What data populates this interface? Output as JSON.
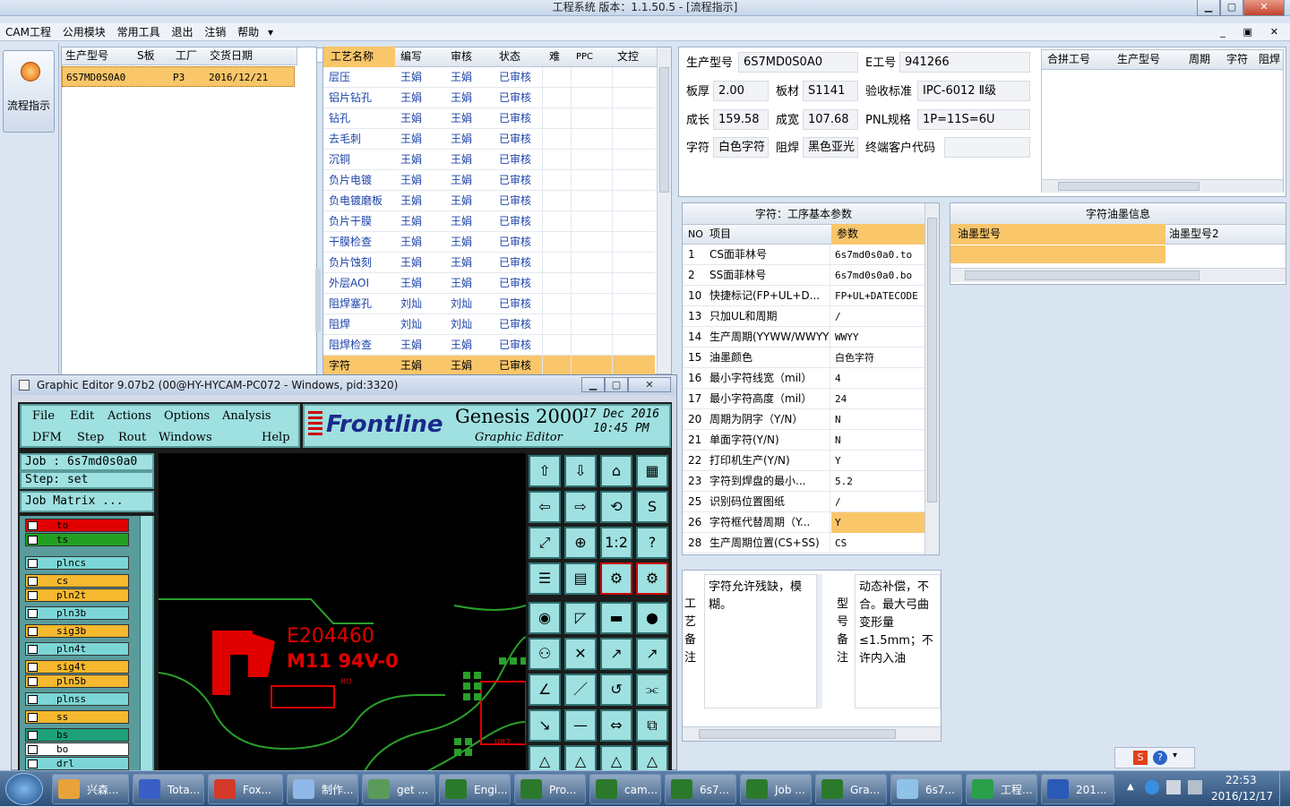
{
  "window": {
    "title": "工程系统   版本：1.1.50.5 - [流程指示]"
  },
  "menu": {
    "items": [
      "CAM工程",
      "公用模块",
      "常用工具",
      "退出",
      "注销",
      "帮助"
    ],
    "dropdown_arrow": "▾",
    "mdi_min": "_",
    "mdi_restore": "▣",
    "mdi_close": "✕"
  },
  "leftnav": {
    "flow_button": "流程指示"
  },
  "orders": {
    "headers": [
      "生产型号",
      "S板",
      "工厂",
      "交货日期"
    ],
    "rows": [
      [
        "6S7MD0S0A0",
        "",
        "P3",
        "2016/12/21"
      ]
    ]
  },
  "process": {
    "headers": [
      "工艺名称",
      "编写",
      "审核",
      "状态",
      "难",
      "PPC",
      "文控"
    ],
    "rows": [
      [
        "层压",
        "王娟",
        "王娟",
        "已审核"
      ],
      [
        "铝片钻孔",
        "王娟",
        "王娟",
        "已审核"
      ],
      [
        "钻孔",
        "王娟",
        "王娟",
        "已审核"
      ],
      [
        "去毛刺",
        "王娟",
        "王娟",
        "已审核"
      ],
      [
        "沉铜",
        "王娟",
        "王娟",
        "已审核"
      ],
      [
        "负片电镀",
        "王娟",
        "王娟",
        "已审核"
      ],
      [
        "负电镀磨板",
        "王娟",
        "王娟",
        "已审核"
      ],
      [
        "负片干膜",
        "王娟",
        "王娟",
        "已审核"
      ],
      [
        "干膜检查",
        "王娟",
        "王娟",
        "已审核"
      ],
      [
        "负片蚀刻",
        "王娟",
        "王娟",
        "已审核"
      ],
      [
        "外层AOI",
        "王娟",
        "王娟",
        "已审核"
      ],
      [
        "阻焊塞孔",
        "刘灿",
        "刘灿",
        "已审核"
      ],
      [
        "阻焊",
        "刘灿",
        "刘灿",
        "已审核"
      ],
      [
        "阻焊检查",
        "王娟",
        "王娟",
        "已审核"
      ],
      [
        "字符",
        "王娟",
        "王娟",
        "已审核"
      ]
    ]
  },
  "info": {
    "model_label": "生产型号",
    "model": "6S7MD0S0A0",
    "eno_label": "E工号",
    "eno": "941266",
    "thick_label": "板厚",
    "thick": "2.00",
    "material_label": "板材",
    "material": "S1141",
    "std_label": "验收标准",
    "std": "IPC-6012 Ⅱ级",
    "len_label": "成长",
    "len": "159.58",
    "wid_label": "成宽",
    "wid": "107.68",
    "pnl_label": "PNL规格",
    "pnl": "1P=11S=6U",
    "char_label": "字符",
    "char": "白色字符",
    "mask_label": "阻焊",
    "mask": "黑色亚光",
    "cust_label": "终端客户代码",
    "cust": ""
  },
  "merge": {
    "headers": [
      "合拼工号",
      "生产型号",
      "周期",
      "字符",
      "阻焊"
    ]
  },
  "params": {
    "title": "字符：工序基本参数",
    "headers": [
      "NO",
      "项目",
      "参数"
    ],
    "rows": [
      [
        "1",
        "CS面菲林号",
        "6s7md0s0a0.to"
      ],
      [
        "2",
        "SS面菲林号",
        "6s7md0s0a0.bo"
      ],
      [
        "10",
        "快捷标记(FP+UL+D...",
        "FP+UL+DATECODE"
      ],
      [
        "13",
        "只加UL和周期",
        "/"
      ],
      [
        "14",
        "生产周期(YYWW/WWYY)",
        "WWYY"
      ],
      [
        "15",
        "油墨颜色",
        "白色字符"
      ],
      [
        "16",
        "最小字符线宽（mil）",
        "4"
      ],
      [
        "17",
        "最小字符高度（mil）",
        "24"
      ],
      [
        "20",
        "周期为阴字（Y/N）",
        "N"
      ],
      [
        "21",
        "单面字符(Y/N)",
        "N"
      ],
      [
        "22",
        "打印机生产(Y/N)",
        "Y"
      ],
      [
        "23",
        "字符到焊盘的最小...",
        "5.2"
      ],
      [
        "25",
        "识别码位置图纸",
        "/"
      ],
      [
        "26",
        "字符框代替周期（Y...",
        "Y"
      ],
      [
        "28",
        "生产周期位置(CS+SS)",
        "CS"
      ]
    ]
  },
  "ink": {
    "title": "字符油墨信息",
    "headers": [
      "油墨型号",
      "油墨型号2"
    ]
  },
  "notes": {
    "left_label": [
      "工",
      "艺",
      "备",
      "注"
    ],
    "left_text": "字符允许残缺，模糊。",
    "right_label": [
      "型",
      "号",
      "备",
      "注"
    ],
    "right_text": "动态补偿，不合。最大弓曲变形量≤1.5mm；不许内入油"
  },
  "ge": {
    "title": "Graphic Editor 9.07b2 (00@HY-HYCAM-PC072 - Windows, pid:3320)",
    "menu1": [
      "File",
      "Edit",
      "Actions",
      "Options",
      "Analysis"
    ],
    "menu2": [
      "DFM",
      "Step",
      "Rout",
      "Windows",
      "Help"
    ],
    "brand": "Frontline",
    "product": "Genesis 2000",
    "subtitle": "Graphic Editor",
    "date": "17 Dec 2016",
    "time": "10:45 PM",
    "job": "Job : 6s7md0s0a0",
    "step": "Step: set",
    "matrix": "Job Matrix ...",
    "board_text1": "E204460",
    "board_text2": "M11 94V-0",
    "board_text3": "U82",
    "ul_mark": "ᴿᵁ",
    "layers": [
      {
        "name": "to",
        "color": "#e00000"
      },
      {
        "name": "ts",
        "color": "#22a022"
      },
      {
        "name": "plncs",
        "color": "#7cd6d6"
      },
      {
        "name": "cs",
        "color": "#f5b82e"
      },
      {
        "name": "pln2t",
        "color": "#f5b82e"
      },
      {
        "name": "pln3b",
        "color": "#7cd6d6"
      },
      {
        "name": "sig3b",
        "color": "#f5b82e"
      },
      {
        "name": "pln4t",
        "color": "#7cd6d6"
      },
      {
        "name": "sig4t",
        "color": "#f5b82e"
      },
      {
        "name": "pln5b",
        "color": "#f5b82e"
      },
      {
        "name": "plnss",
        "color": "#7cd6d6"
      },
      {
        "name": "ss",
        "color": "#f5b82e"
      },
      {
        "name": "bs",
        "color": "#1ea07a"
      },
      {
        "name": "bo",
        "color": "#ffffff"
      },
      {
        "name": "drl",
        "color": "#7cd6d6"
      }
    ],
    "tools": [
      "⇧",
      "⇩",
      "⌂",
      "▦",
      "⇦",
      "⇨",
      "⟲",
      "S",
      "⤢",
      "⊕",
      "1:2",
      "?",
      "☰",
      "▤",
      "⚙",
      "⚙",
      "◉",
      "◸",
      "▬",
      "●",
      "⚇",
      "✕",
      "↗",
      "↗",
      "∠",
      "／",
      "↺",
      "⫘",
      "↘",
      "—",
      "⇔",
      "⧉",
      "△",
      "△",
      "△",
      "△"
    ]
  },
  "taskbar": {
    "items": [
      "兴森...",
      "Tota...",
      "Fox...",
      "制作...",
      "get ...",
      "Engi...",
      "Pro...",
      "cam...",
      "6s7...",
      "Job ...",
      "Gra...",
      "6s7...",
      "工程...",
      "201..."
    ],
    "icon_colors": [
      "#e8a23a",
      "#3a5ec8",
      "#d33a2a",
      "#8fb8e8",
      "#5a9a5a",
      "#2b7a2b",
      "#2b7a2b",
      "#2b7a2b",
      "#2b7a2b",
      "#2b7a2b",
      "#2b7a2b",
      "#8ec2e8",
      "#2aa04a",
      "#2a5ab8"
    ],
    "time": "22:53",
    "date": "2016/12/17"
  }
}
